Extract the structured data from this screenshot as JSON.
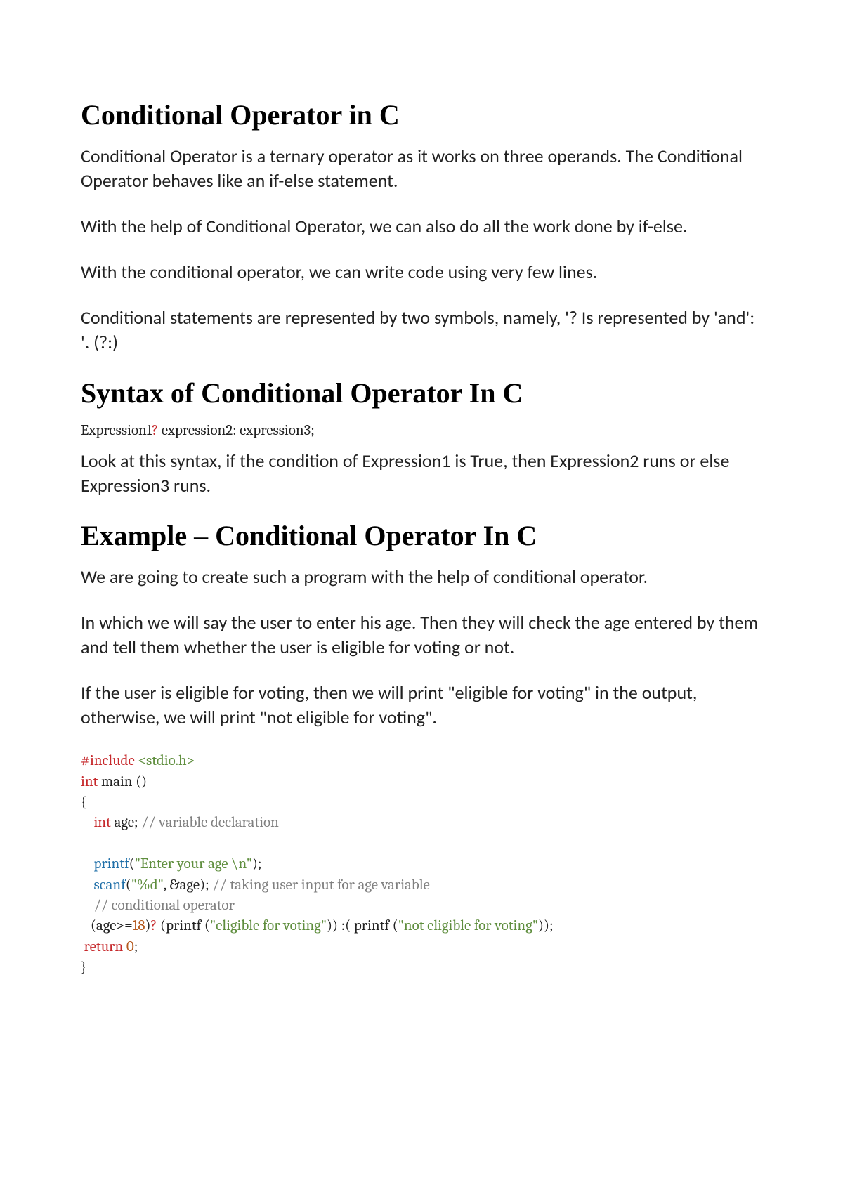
{
  "h1": "Conditional Operator in C",
  "p1": "Conditional Operator is a ternary operator as it works on three operands. The Conditional Operator behaves like an if-else statement.",
  "p2": "With the help of Conditional Operator, we can also do all the work done by if-else.",
  "p3": "With the conditional operator, we can write code using very few lines.",
  "p4": "Conditional statements are represented by two symbols, namely, '? Is represented by 'and': '. (?:)",
  "h2": "Syntax of Conditional Operator In C",
  "syntax": {
    "expr1": "Expression1",
    "q": "?",
    "rest": " expression2: expression3;"
  },
  "p5": "Look at this syntax, if the condition of Expression1 is True, then Expression2 runs or else Expression3 runs.",
  "h3": "Example – Conditional Operator In C",
  "p6": "We are going to create such a program with the help of conditional operator.",
  "p7": "In which we will say the user to enter his age. Then they will check the age entered by them and tell them whether the user is eligible for voting or not.",
  "p8": "If the user is eligible for voting, then we will print \"eligible for voting\" in the output, otherwise, we will print \"not eligible for voting\".",
  "code": {
    "include": "#include",
    "header": " <stdio.h>",
    "int1": "int",
    "main": " main ()",
    "lbrace": "{",
    "indent": "    ",
    "int2": "int",
    "agev": " age; ",
    "c1": "// variable declaration",
    "printf": "printf",
    "p_open": "(",
    "s1": "\"Enter your age \\n\"",
    "p_close1": ");",
    "scanf": "scanf",
    "s2": "\"%d\"",
    "comma_amp": ", &",
    "age2": "age",
    "p_close2": "); ",
    "c2": "// taking user input for age variable",
    "c3": "// conditional operator",
    "indent2": "   ",
    "cond_l": "(age>=",
    "eighteen": "18",
    "cond_r": ")",
    "q2": "?",
    "mid1": " (printf (",
    "s3": "\"eligible for voting\"",
    "mid2": ")) :( printf (",
    "s4": "\"not eligible for voting\"",
    "mid3": "));",
    "return_sp": " ",
    "return": "return",
    "zero": " 0",
    "semi": ";",
    "rbrace": "}"
  }
}
